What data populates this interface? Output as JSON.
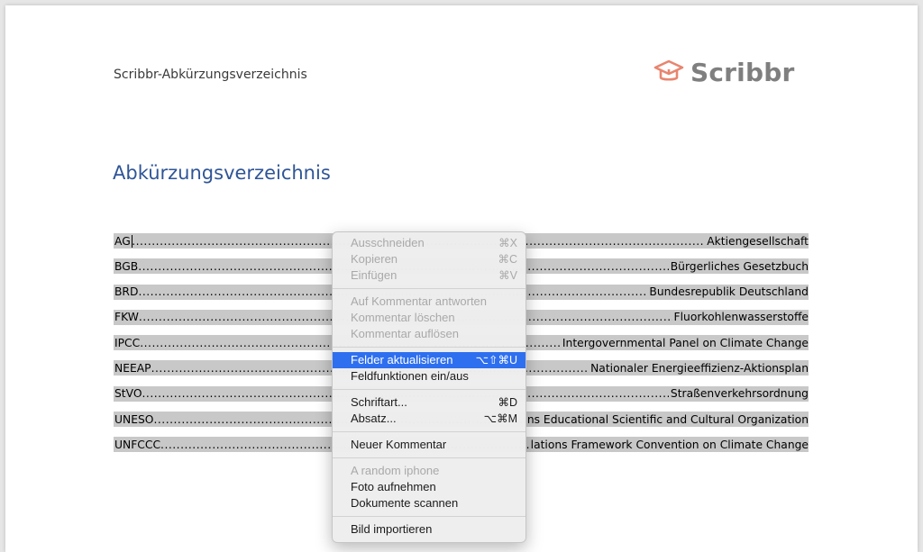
{
  "document": {
    "header": "Scribbr-Abkürzungsverzeichnis",
    "logo": {
      "text": "Scribbr",
      "color": "#e8856f"
    },
    "title": "Abkürzungsverzeichnis",
    "title_color": "#2f5597",
    "entries": [
      {
        "abbr": "AG",
        "desc": "Aktiengesellschaft"
      },
      {
        "abbr": "BGB",
        "desc": "Bürgerliches Gesetzbuch"
      },
      {
        "abbr": "BRD",
        "desc": "Bundesrepublik Deutschland"
      },
      {
        "abbr": "FKW",
        "desc": "Fluorkohlenwasserstoffe"
      },
      {
        "abbr": "IPCC",
        "desc": "Intergovernmental Panel on Climate Change"
      },
      {
        "abbr": "NEEAP",
        "desc": "Nationaler Energieeffizienz-Aktionsplan"
      },
      {
        "abbr": "StVO",
        "desc": "Straßenverkehrsordnung"
      },
      {
        "abbr": "UNESO",
        "desc": "ns Educational Scientific and Cultural Organization"
      },
      {
        "abbr": "UNFCCC",
        "desc": "lations Framework Convention on Climate Change"
      }
    ]
  },
  "context_menu": {
    "highlight_color": "#2e6ff0",
    "items": [
      {
        "label": "Ausschneiden",
        "shortcut": "⌘X",
        "disabled": true
      },
      {
        "label": "Kopieren",
        "shortcut": "⌘C",
        "disabled": true
      },
      {
        "label": "Einfügen",
        "shortcut": "⌘V",
        "disabled": true
      },
      {
        "label": "Auf Kommentar antworten",
        "shortcut": "",
        "disabled": true
      },
      {
        "label": "Kommentar löschen",
        "shortcut": "",
        "disabled": true
      },
      {
        "label": "Kommentar auflösen",
        "shortcut": "",
        "disabled": true
      },
      {
        "label": "Felder aktualisieren",
        "shortcut": "⌥⇧⌘U",
        "disabled": false,
        "highlighted": true
      },
      {
        "label": "Feldfunktionen ein/aus",
        "shortcut": "",
        "disabled": false
      },
      {
        "label": "Schriftart...",
        "shortcut": "⌘D",
        "disabled": false
      },
      {
        "label": "Absatz...",
        "shortcut": "⌥⌘M",
        "disabled": false
      },
      {
        "label": "Neuer Kommentar",
        "shortcut": "",
        "disabled": false
      },
      {
        "label": "A random iphone",
        "shortcut": "",
        "disabled": true
      },
      {
        "label": "Foto aufnehmen",
        "shortcut": "",
        "disabled": false
      },
      {
        "label": "Dokumente scannen",
        "shortcut": "",
        "disabled": false
      },
      {
        "label": "Bild importieren",
        "shortcut": "",
        "disabled": false
      }
    ]
  }
}
